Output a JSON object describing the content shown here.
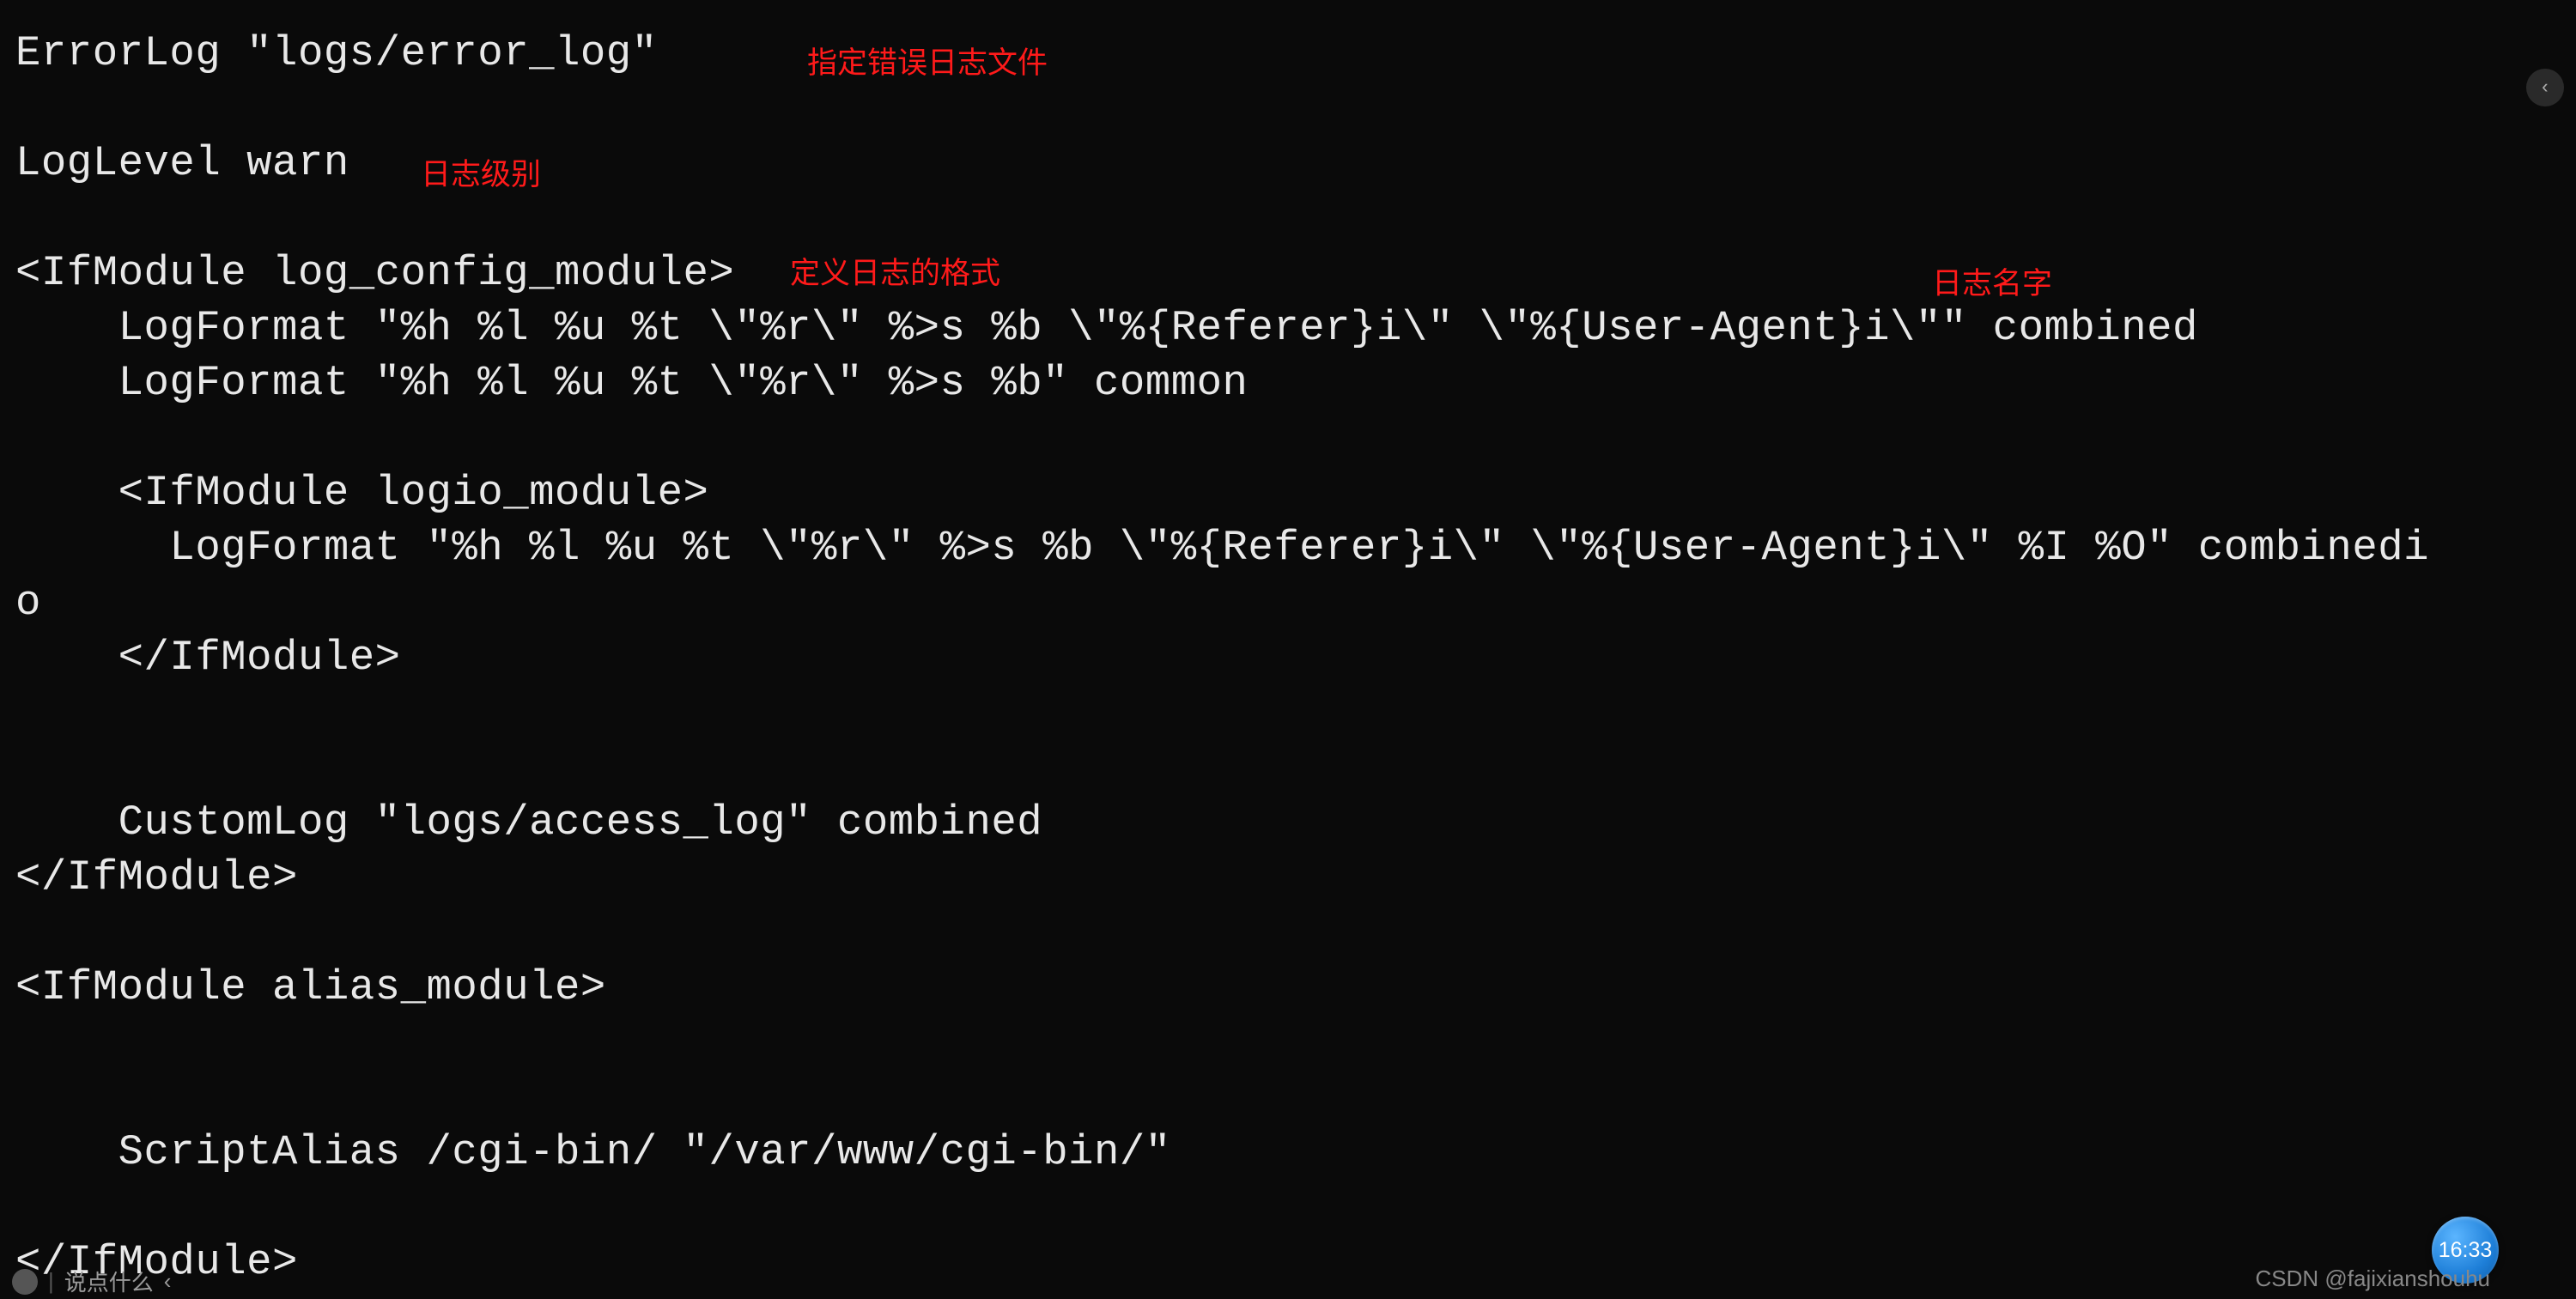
{
  "code": {
    "line1": "ErrorLog \"logs/error_log\"",
    "line2": "",
    "line3": "LogLevel warn",
    "line4": "",
    "line5": "<IfModule log_config_module>",
    "line6": "    LogFormat \"%h %l %u %t \\\"%r\\\" %>s %b \\\"%{Referer}i\\\" \\\"%{User-Agent}i\\\"\" combined",
    "line7": "    LogFormat \"%h %l %u %t \\\"%r\\\" %>s %b\" common",
    "line8": "",
    "line9": "    <IfModule logio_module>",
    "line10": "      LogFormat \"%h %l %u %t \\\"%r\\\" %>s %b \\\"%{Referer}i\\\" \\\"%{User-Agent}i\\\" %I %O\" combinedi",
    "line11": "o",
    "line12": "    </IfModule>",
    "line13": "",
    "line14": "",
    "line15": "    CustomLog \"logs/access_log\" combined",
    "line16": "</IfModule>",
    "line17": "",
    "line18": "<IfModule alias_module>",
    "line19": "",
    "line20": "",
    "line21": "    ScriptAlias /cgi-bin/ \"/var/www/cgi-bin/\"",
    "line22": "",
    "line23": "</IfModule>"
  },
  "annotations": {
    "errorlog": "指定错误日志文件",
    "loglevel": "日志级别",
    "logformat": "定义日志的格式",
    "logname": "日志名字"
  },
  "ui": {
    "expand_icon": "‹",
    "clock_time": "16:33",
    "watermark": "CSDN @fajixianshouhu",
    "bottom_text": "说点什么",
    "bottom_arrow": "‹"
  }
}
